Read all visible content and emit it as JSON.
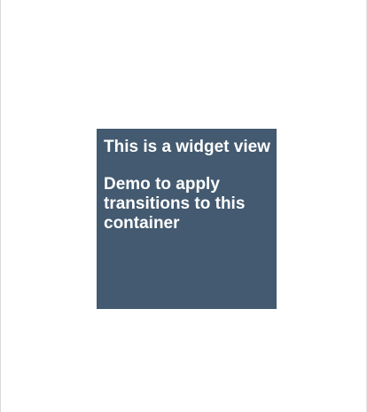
{
  "widget": {
    "title": "This is a widget view",
    "body": "Demo to apply transitions to this container",
    "background_color": "#435A70",
    "text_color": "#FFFFFF"
  }
}
